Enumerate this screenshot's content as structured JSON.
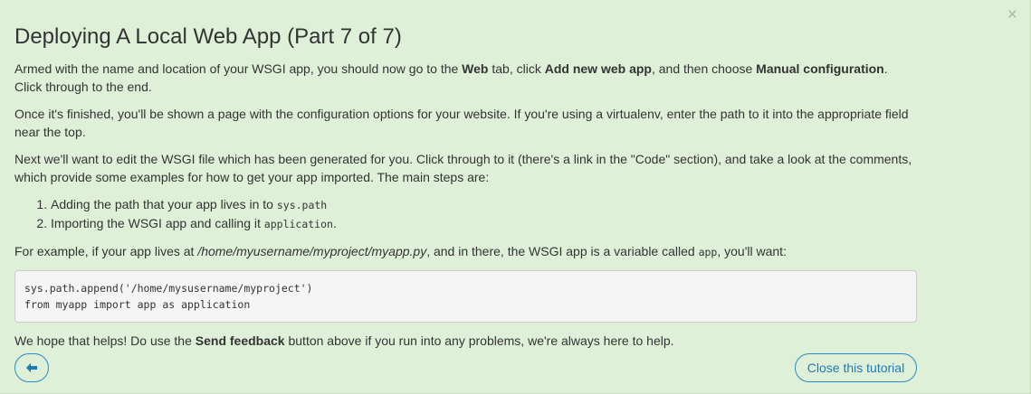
{
  "dialog": {
    "close_glyph": "×",
    "title": "Deploying A Local Web App (Part 7 of 7)"
  },
  "para1": {
    "t1": "Armed with the name and location of your WSGI app, you should now go to the ",
    "b1": "Web",
    "t2": " tab, click ",
    "b2": "Add new web app",
    "t3": ", and then choose ",
    "b3": "Manual configuration",
    "t4": ". Click through to the end."
  },
  "para2": {
    "text": "Once it's finished, you'll be shown a page with the configuration options for your website. If you're using a virtualenv, enter the path to it into the appropriate field near the top."
  },
  "para3": {
    "text": "Next we'll want to edit the WSGI file which has been generated for you. Click through to it (there's a link in the \"Code\" section), and take a look at the comments, which provide some examples for how to get your app imported. The main steps are:"
  },
  "steps": [
    {
      "text": "Adding the path that your app lives in to ",
      "code": "sys.path",
      "suffix": ""
    },
    {
      "text": "Importing the WSGI app and calling it ",
      "code": "application",
      "suffix": "."
    }
  ],
  "para4": {
    "t1": "For example, if your app lives at ",
    "path": "/home/myusername/myproject/myapp.py",
    "t2": ", and in there, the WSGI app is a variable called ",
    "code": "app",
    "t3": ", you'll want:"
  },
  "code_block": {
    "line1": "sys.path.append('/home/mysusername/myproject')",
    "line2": "from myapp import app as application"
  },
  "para5": {
    "t1": "We hope that helps! Do use the ",
    "b1": "Send feedback",
    "t2": " button above if you run into any problems, we're always here to help."
  },
  "footer": {
    "close_label": "Close this tutorial"
  },
  "colors": {
    "background": "#dff0d8",
    "accent": "#1f7ab3",
    "text": "#333333"
  }
}
